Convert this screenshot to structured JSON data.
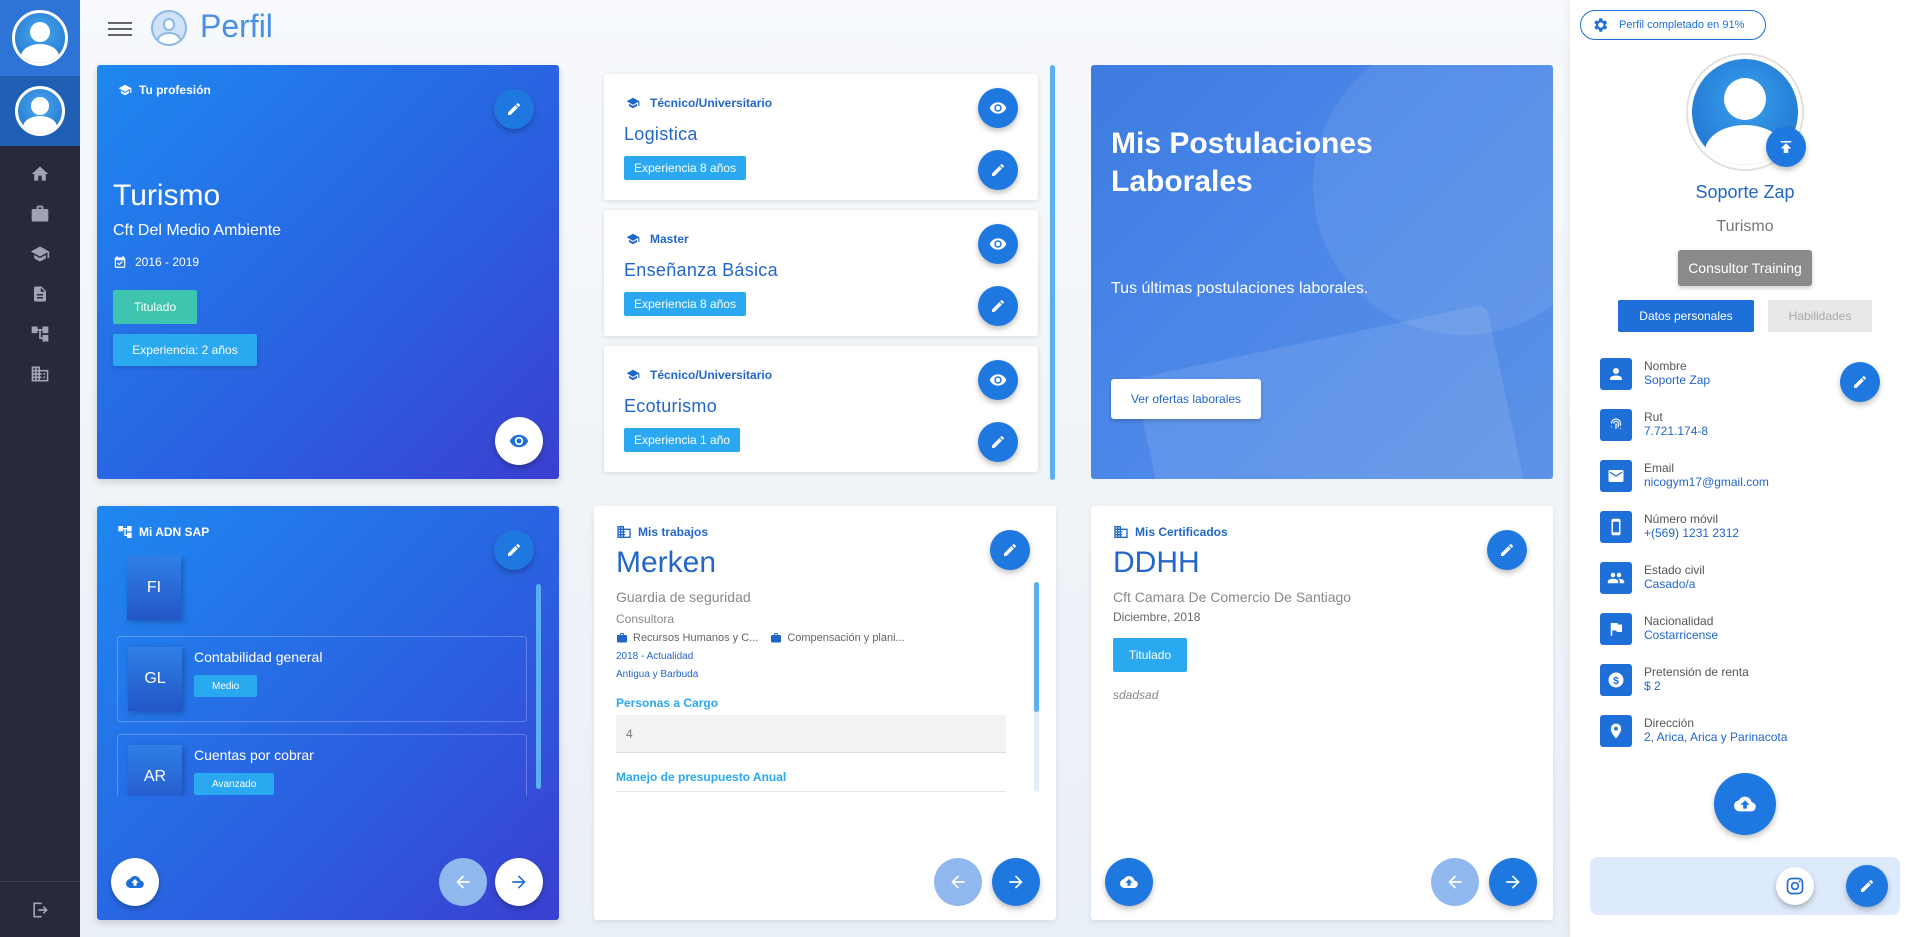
{
  "header": {
    "title": "Perfil"
  },
  "sidebar": {
    "icons": [
      "home-icon",
      "briefcase-icon",
      "graduation-cap-icon",
      "document-icon",
      "sitemap-icon",
      "building-icon"
    ],
    "exit_icon": "exit-icon"
  },
  "profession_card": {
    "label": "Tu profesión",
    "title": "Turismo",
    "institution": "Cft Del Medio Ambiente",
    "period": "2016 - 2019",
    "status": "Titulado",
    "experience": "Experiencia: 2 años"
  },
  "studies": [
    {
      "type": "Técnico/Universitario",
      "title": "Logistica",
      "experience": "Experiencia 8 años"
    },
    {
      "type": "Master",
      "title": "Enseñanza Básica",
      "experience": "Experiencia 8 años"
    },
    {
      "type": "Técnico/Universitario",
      "title": "Ecoturismo",
      "experience": "Experiencia 1 año"
    }
  ],
  "postulaciones": {
    "title": "Mis Postulaciones Laborales",
    "subtitle": "Tus últimas postulaciones laborales.",
    "button": "Ver ofertas laborales"
  },
  "sap": {
    "label": "Mi ADN SAP",
    "items": [
      {
        "code": "FI",
        "name": "",
        "level": ""
      },
      {
        "code": "GL",
        "name": "Contabilidad general",
        "level": "Medio"
      },
      {
        "code": "AR",
        "name": "Cuentas por cobrar",
        "level": "Avanzado"
      }
    ]
  },
  "jobs": {
    "label": "Mis trabajos",
    "company": "Merken",
    "role": "Guardia de seguridad",
    "kind": "Consultora",
    "tags": [
      "Recursos Humanos y C...",
      "Compensación y plani..."
    ],
    "period": "2018 - Actualidad",
    "country": "Antigua y Barbuda",
    "field1_label": "Personas a Cargo",
    "field1_value": "4",
    "field2_label": "Manejo de presupuesto Anual"
  },
  "certificates": {
    "label": "Mis Certificados",
    "name": "DDHH",
    "institution": "Cft Camara De Comercio De Santiago",
    "date": "Diciembre, 2018",
    "status": "Titulado",
    "note": "sdadsad"
  },
  "right_panel": {
    "progress": "Perfil completado en 91%",
    "name": "Soporte Zap",
    "profession": "Turismo",
    "chip": "Consultor Training",
    "tab_active": "Datos personales",
    "tab_inactive": "Habilidades",
    "fields": [
      {
        "icon": "person-icon",
        "label": "Nombre",
        "value": "Soporte Zap"
      },
      {
        "icon": "fingerprint-icon",
        "label": "Rut",
        "value": "7.721.174-8"
      },
      {
        "icon": "mail-icon",
        "label": "Email",
        "value": "nicogym17@gmail.com"
      },
      {
        "icon": "phone-icon",
        "label": "Número móvil",
        "value": "+(569) 1231 2312"
      },
      {
        "icon": "people-icon",
        "label": "Estado civil",
        "value": "Casado/a"
      },
      {
        "icon": "flag-icon",
        "label": "Nacionalidad",
        "value": "Costarricense"
      },
      {
        "icon": "dollar-icon",
        "label": "Pretensión de renta",
        "value": "$ 2"
      },
      {
        "icon": "location-icon",
        "label": "Dirección",
        "value": "2, Arica, Arica y Parinacota"
      }
    ]
  },
  "colors": {
    "primary": "#1e6fd8",
    "accent": "#2aa8f0",
    "sidebar": "#262a3a",
    "success": "#3dc5b0"
  }
}
